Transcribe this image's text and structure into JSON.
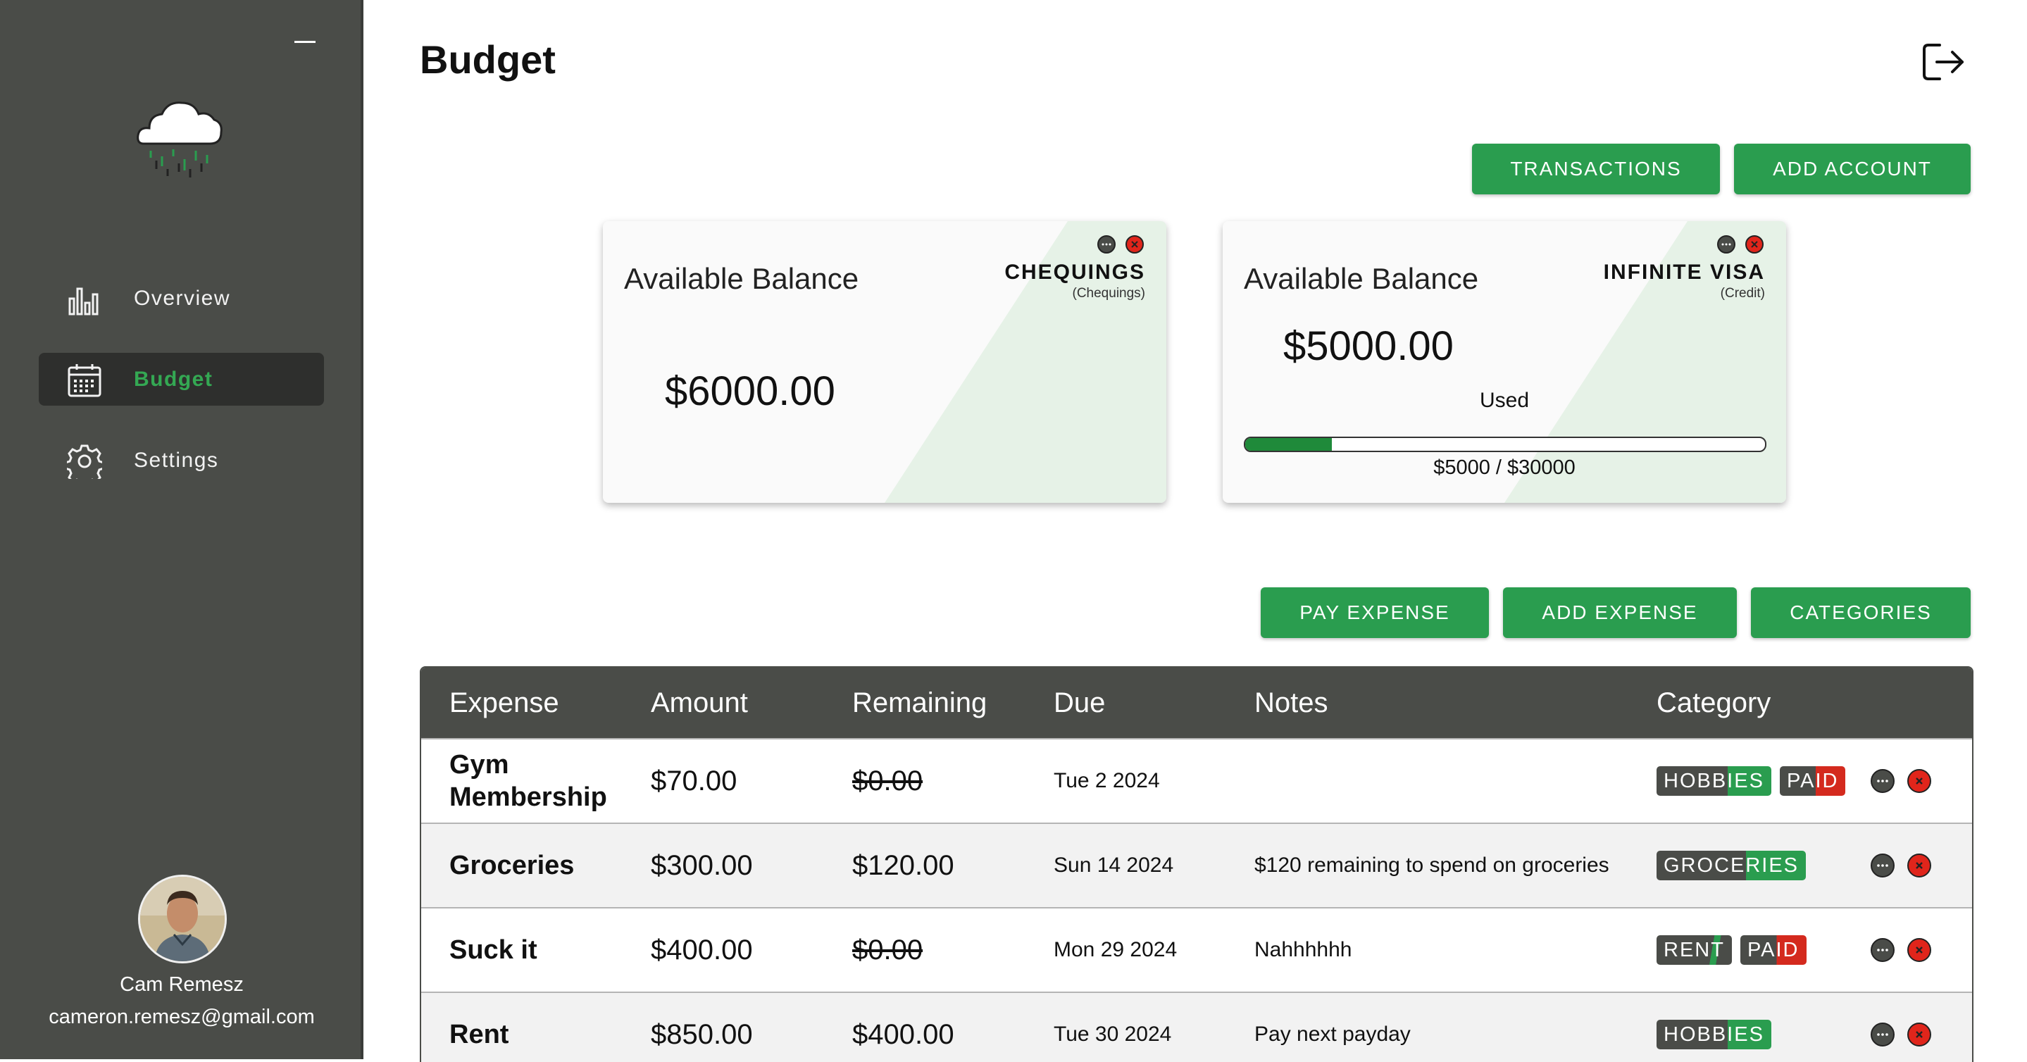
{
  "sidebar": {
    "nav": [
      {
        "label": "Overview",
        "icon": "bar-chart-icon"
      },
      {
        "label": "Budget",
        "icon": "calendar-icon"
      },
      {
        "label": "Settings",
        "icon": "gear-icon"
      }
    ],
    "user": {
      "name": "Cam Remesz",
      "email": "cameron.remesz@gmail.com"
    }
  },
  "header": {
    "title": "Budget"
  },
  "actions": {
    "transactions": "TRANSACTIONS",
    "add_account": "ADD ACCOUNT"
  },
  "accounts": [
    {
      "label": "Available Balance",
      "name": "CHEQUINGS",
      "type": "(Chequings)",
      "balance": "$6000.00"
    },
    {
      "label": "Available Balance",
      "name": "INFINITE VISA",
      "type": "(Credit)",
      "balance": "$5000.00",
      "used_label": "Used",
      "usage_text": "$5000 / $30000",
      "usage_fraction": 0.1667
    }
  ],
  "expense_actions": {
    "pay": "PAY EXPENSE",
    "add": "ADD EXPENSE",
    "categories": "CATEGORIES"
  },
  "table": {
    "headers": [
      "Expense",
      "Amount",
      "Remaining",
      "Due",
      "Notes",
      "Category"
    ],
    "rows": [
      {
        "expense": "Gym Membership",
        "amount": "$70.00",
        "remaining": "$0.00",
        "remaining_struck": true,
        "due": "Tue 2 2024",
        "notes": "",
        "badges": [
          "HOBBIES",
          "PAID"
        ]
      },
      {
        "expense": "Groceries",
        "amount": "$300.00",
        "remaining": "$120.00",
        "remaining_struck": false,
        "due": "Sun 14 2024",
        "notes": "$120 remaining to spend on groceries",
        "badges": [
          "GROCERIES"
        ]
      },
      {
        "expense": "Suck it",
        "amount": "$400.00",
        "remaining": "$0.00",
        "remaining_struck": true,
        "due": "Mon 29 2024",
        "notes": "Nahhhhhh",
        "badges": [
          "RENT",
          "PAID"
        ]
      },
      {
        "expense": "Rent",
        "amount": "$850.00",
        "remaining": "$400.00",
        "remaining_struck": false,
        "due": "Tue 30 2024",
        "notes": "Pay next payday",
        "badges": [
          "HOBBIES"
        ]
      }
    ]
  },
  "colors": {
    "accent": "#2a9d4f",
    "sidebar": "#4a4c48",
    "danger": "#e0251b",
    "paid": "#d42a1e"
  }
}
